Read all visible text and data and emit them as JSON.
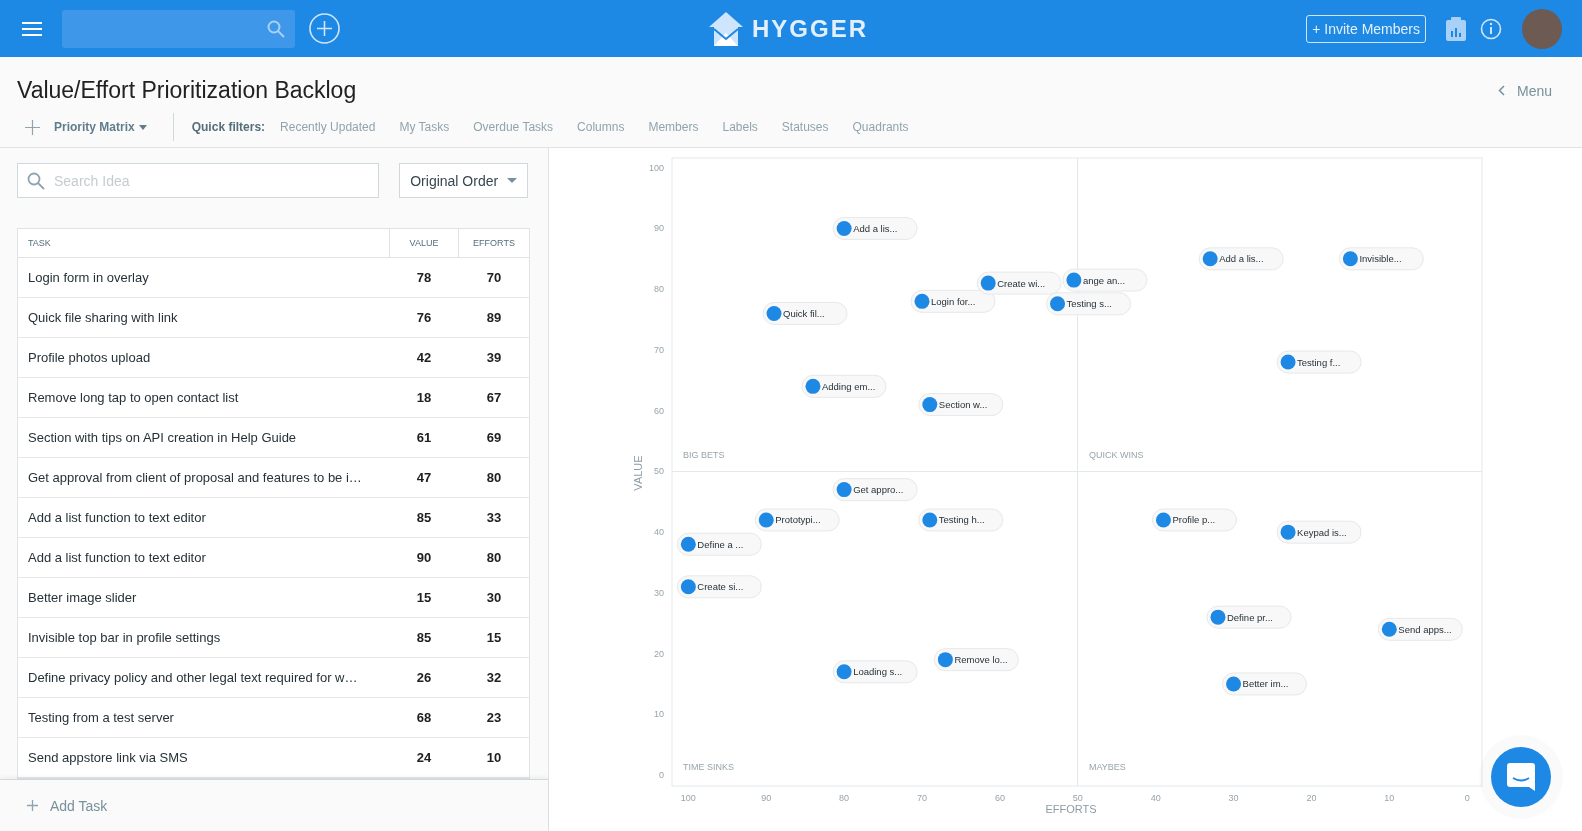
{
  "topbar": {
    "logo": "HYGGER",
    "invite_button": "+ Invite Members"
  },
  "page": {
    "title": "Value/Effort Prioritization Backlog",
    "menu_link": "Menu"
  },
  "toolbar": {
    "view_selector": "Priority Matrix",
    "quick_filters_label": "Quick filters:",
    "quick_filters": [
      "Recently Updated",
      "My Tasks",
      "Overdue Tasks",
      "Columns",
      "Members",
      "Labels",
      "Statuses",
      "Quadrants"
    ]
  },
  "backlog": {
    "search": {
      "placeholder": "Search Idea"
    },
    "sort": {
      "value": "Original Order"
    },
    "table": {
      "columns": [
        "TASK",
        "VALUE",
        "EFFORTS"
      ],
      "rows": [
        {
          "task": "Login form in overlay",
          "value": "78",
          "efforts": "70"
        },
        {
          "task": "Quick file sharing with link",
          "value": "76",
          "efforts": "89"
        },
        {
          "task": "Profile photos upload",
          "value": "42",
          "efforts": "39"
        },
        {
          "task": "Remove long tap to open contact list",
          "value": "18",
          "efforts": "67"
        },
        {
          "task": "Section with tips on API creation in Help Guide",
          "value": "61",
          "efforts": "69"
        },
        {
          "task": "Get approval from client of proposal and features to be i…",
          "value": "47",
          "efforts": "80"
        },
        {
          "task": "Add a list function to text editor",
          "value": "85",
          "efforts": "33"
        },
        {
          "task": "Add a list function to text editor",
          "value": "90",
          "efforts": "80"
        },
        {
          "task": "Better image slider",
          "value": "15",
          "efforts": "30"
        },
        {
          "task": "Invisible top bar in profile settings",
          "value": "85",
          "efforts": "15"
        },
        {
          "task": "Define privacy policy and other legal text required for w…",
          "value": "26",
          "efforts": "32"
        },
        {
          "task": "Testing from a test server",
          "value": "68",
          "efforts": "23"
        },
        {
          "task": "Send appstore link via SMS",
          "value": "24",
          "efforts": "10"
        }
      ]
    },
    "add_task": "Add Task"
  },
  "matrix": {
    "chart_data": {
      "type": "scatter",
      "xlabel": "EFFORTS",
      "ylabel": "VALUE",
      "xlim": [
        102.1,
        -1.9
      ],
      "ylim": [
        -1.8,
        101.6
      ],
      "xticks": [
        100,
        90,
        80,
        70,
        60,
        50,
        40,
        30,
        20,
        10,
        0
      ],
      "yticks": [
        0,
        10,
        20,
        30,
        40,
        50,
        60,
        70,
        80,
        90,
        100
      ],
      "x": [
        80,
        89,
        70,
        50.5,
        61.5,
        52.6,
        84,
        69,
        33,
        15,
        23,
        80,
        90,
        69,
        100,
        100,
        80,
        67,
        39,
        23,
        32,
        10,
        30
      ],
      "value_labels": [
        "Add a lis...",
        "Quick fil...",
        "Login for...",
        "ange an...",
        "Create wi...",
        "Testing s...",
        "Adding em...",
        "Section w...",
        "Add a lis...",
        "Invisible...",
        "Testing f...",
        "Get appro...",
        "Prototypi...",
        "Testing h...",
        "Define a ...",
        "Create si...",
        "Loading s...",
        "Remove lo...",
        "Profile p...",
        "Keypad is...",
        "Define pr...",
        "Send apps...",
        "Better im..."
      ],
      "series": [
        {
          "color": "#1e88e5",
          "values": [
            90,
            76,
            78,
            81.5,
            81,
            77.6,
            64,
            61,
            85,
            85,
            68,
            47,
            42,
            42,
            38,
            31,
            17,
            19,
            42,
            40,
            26,
            24,
            15
          ]
        }
      ],
      "annotations": [
        "BIG BETS",
        "QUICK WINS",
        "TIME SINKS",
        "MAYBES"
      ]
    }
  }
}
